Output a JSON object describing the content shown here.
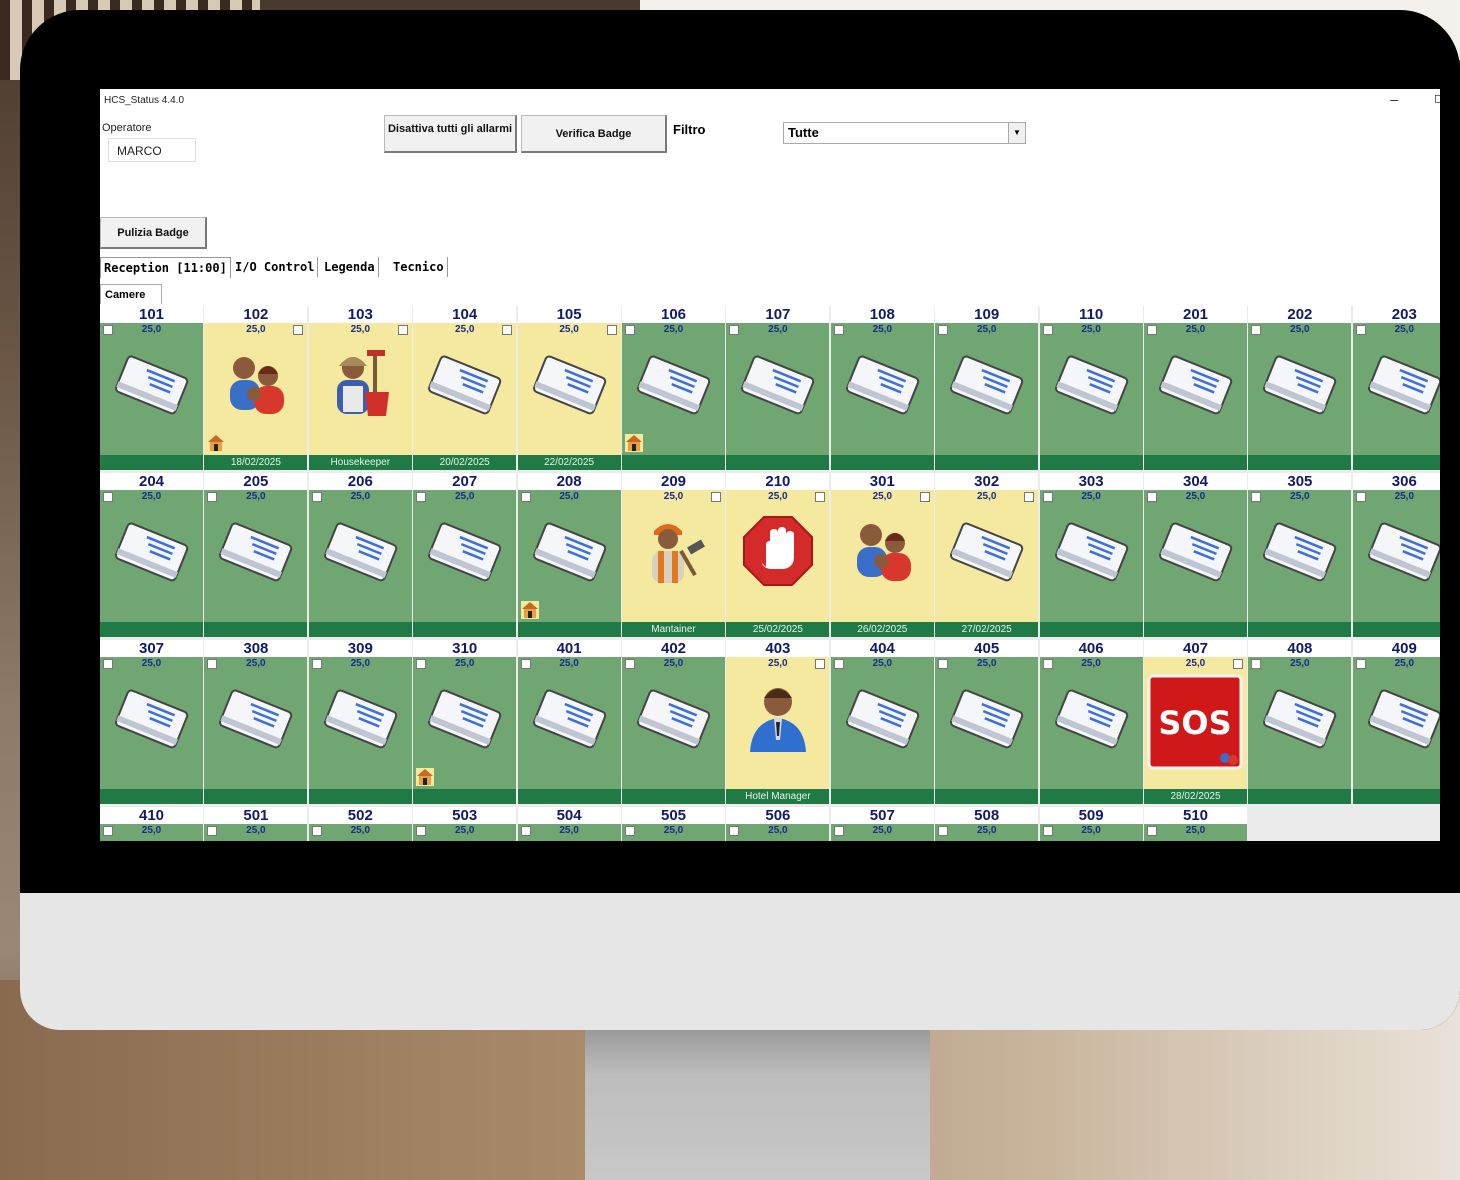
{
  "window": {
    "title": "HCS_Status 4.4.0",
    "minimize": "–",
    "restore": "◻"
  },
  "operator": {
    "label": "Operatore",
    "value": "MARCO"
  },
  "buttons": {
    "disattiva": "Disattiva tutti gli allarmi",
    "verifica": "Verifica Badge",
    "pulizia": "Pulizia Badge"
  },
  "filter": {
    "label": "Filtro",
    "value": "Tutte"
  },
  "tabs": [
    "Reception [11:00]",
    "I/O Control",
    "Legenda",
    "Tecnico"
  ],
  "subtab": "Camere",
  "rooms": [
    {
      "number": "101",
      "temp": "25,0",
      "state": "green",
      "icon": "card-icon",
      "footer": ""
    },
    {
      "number": "102",
      "temp": "25,0",
      "state": "yellow",
      "icon": "guests-icon",
      "footer": "18/02/2025",
      "house": true
    },
    {
      "number": "103",
      "temp": "25,0",
      "state": "yellow",
      "icon": "housekeeper-icon",
      "footer": "Housekeeper"
    },
    {
      "number": "104",
      "temp": "25,0",
      "state": "yellow",
      "icon": "card-icon",
      "footer": "20/02/2025"
    },
    {
      "number": "105",
      "temp": "25,0",
      "state": "yellow",
      "icon": "card-icon",
      "footer": "22/02/2025"
    },
    {
      "number": "106",
      "temp": "25,0",
      "state": "green",
      "icon": "card-icon",
      "footer": "",
      "house": true
    },
    {
      "number": "107",
      "temp": "25,0",
      "state": "green",
      "icon": "card-icon",
      "footer": ""
    },
    {
      "number": "108",
      "temp": "25,0",
      "state": "green",
      "icon": "card-icon",
      "footer": ""
    },
    {
      "number": "109",
      "temp": "25,0",
      "state": "green",
      "icon": "card-icon",
      "footer": ""
    },
    {
      "number": "110",
      "temp": "25,0",
      "state": "green",
      "icon": "card-icon",
      "footer": ""
    },
    {
      "number": "201",
      "temp": "25,0",
      "state": "green",
      "icon": "card-icon",
      "footer": ""
    },
    {
      "number": "202",
      "temp": "25,0",
      "state": "green",
      "icon": "card-icon",
      "footer": ""
    },
    {
      "number": "203",
      "temp": "25,0",
      "state": "green",
      "icon": "card-icon",
      "footer": ""
    },
    {
      "number": "204",
      "temp": "25,0",
      "state": "green",
      "icon": "card-icon",
      "footer": ""
    },
    {
      "number": "205",
      "temp": "25,0",
      "state": "green",
      "icon": "card-icon",
      "footer": ""
    },
    {
      "number": "206",
      "temp": "25,0",
      "state": "green",
      "icon": "card-icon",
      "footer": ""
    },
    {
      "number": "207",
      "temp": "25,0",
      "state": "green",
      "icon": "card-icon",
      "footer": ""
    },
    {
      "number": "208",
      "temp": "25,0",
      "state": "green",
      "icon": "card-icon",
      "footer": "",
      "house": true
    },
    {
      "number": "209",
      "temp": "25,0",
      "state": "yellow",
      "icon": "maintainer-icon",
      "footer": "Mantainer"
    },
    {
      "number": "210",
      "temp": "25,0",
      "state": "yellow",
      "icon": "stop-hand-icon",
      "footer": "25/02/2025"
    },
    {
      "number": "301",
      "temp": "25,0",
      "state": "yellow",
      "icon": "guests-icon",
      "footer": "26/02/2025"
    },
    {
      "number": "302",
      "temp": "25,0",
      "state": "yellow",
      "icon": "card-icon",
      "footer": "27/02/2025"
    },
    {
      "number": "303",
      "temp": "25,0",
      "state": "green",
      "icon": "card-icon",
      "footer": ""
    },
    {
      "number": "304",
      "temp": "25,0",
      "state": "green",
      "icon": "card-icon",
      "footer": ""
    },
    {
      "number": "305",
      "temp": "25,0",
      "state": "green",
      "icon": "card-icon",
      "footer": ""
    },
    {
      "number": "306",
      "temp": "25,0",
      "state": "green",
      "icon": "card-icon",
      "footer": ""
    },
    {
      "number": "307",
      "temp": "25,0",
      "state": "green",
      "icon": "card-icon",
      "footer": ""
    },
    {
      "number": "308",
      "temp": "25,0",
      "state": "green",
      "icon": "card-icon",
      "footer": ""
    },
    {
      "number": "309",
      "temp": "25,0",
      "state": "green",
      "icon": "card-icon",
      "footer": ""
    },
    {
      "number": "310",
      "temp": "25,0",
      "state": "green",
      "icon": "card-icon",
      "footer": "",
      "house": true
    },
    {
      "number": "401",
      "temp": "25,0",
      "state": "green",
      "icon": "card-icon",
      "footer": ""
    },
    {
      "number": "402",
      "temp": "25,0",
      "state": "green",
      "icon": "card-icon",
      "footer": ""
    },
    {
      "number": "403",
      "temp": "25,0",
      "state": "yellow",
      "icon": "manager-icon",
      "footer": "Hotel Manager"
    },
    {
      "number": "404",
      "temp": "25,0",
      "state": "green",
      "icon": "card-icon",
      "footer": ""
    },
    {
      "number": "405",
      "temp": "25,0",
      "state": "green",
      "icon": "card-icon",
      "footer": ""
    },
    {
      "number": "406",
      "temp": "25,0",
      "state": "green",
      "icon": "card-icon",
      "footer": ""
    },
    {
      "number": "407",
      "temp": "25,0",
      "state": "yellow",
      "icon": "sos-icon",
      "footer": "28/02/2025",
      "sos": "SOS"
    },
    {
      "number": "408",
      "temp": "25,0",
      "state": "green",
      "icon": "card-icon",
      "footer": ""
    },
    {
      "number": "409",
      "temp": "25,0",
      "state": "green",
      "icon": "card-icon",
      "footer": ""
    },
    {
      "number": "410",
      "temp": "25,0",
      "state": "green",
      "icon": "card-icon",
      "footer": ""
    },
    {
      "number": "501",
      "temp": "25,0",
      "state": "green",
      "icon": "card-icon",
      "footer": ""
    },
    {
      "number": "502",
      "temp": "25,0",
      "state": "green",
      "icon": "card-icon",
      "footer": ""
    },
    {
      "number": "503",
      "temp": "25,0",
      "state": "green",
      "icon": "card-icon",
      "footer": ""
    },
    {
      "number": "504",
      "temp": "25,0",
      "state": "green",
      "icon": "card-icon",
      "footer": ""
    },
    {
      "number": "505",
      "temp": "25,0",
      "state": "green",
      "icon": "card-icon",
      "footer": ""
    },
    {
      "number": "506",
      "temp": "25,0",
      "state": "green",
      "icon": "card-icon",
      "footer": ""
    },
    {
      "number": "507",
      "temp": "25,0",
      "state": "green",
      "icon": "card-icon",
      "footer": ""
    },
    {
      "number": "508",
      "temp": "25,0",
      "state": "green",
      "icon": "card-icon",
      "footer": ""
    },
    {
      "number": "509",
      "temp": "25,0",
      "state": "green",
      "icon": "card-icon",
      "footer": ""
    },
    {
      "number": "510",
      "temp": "25,0",
      "state": "green",
      "icon": "card-icon",
      "footer": ""
    }
  ],
  "colors": {
    "room_free": "#6fa672",
    "room_occupied": "#f5e9a0",
    "footer": "#1f7a45",
    "room_number": "#121a6a",
    "sos": "#d01818"
  }
}
